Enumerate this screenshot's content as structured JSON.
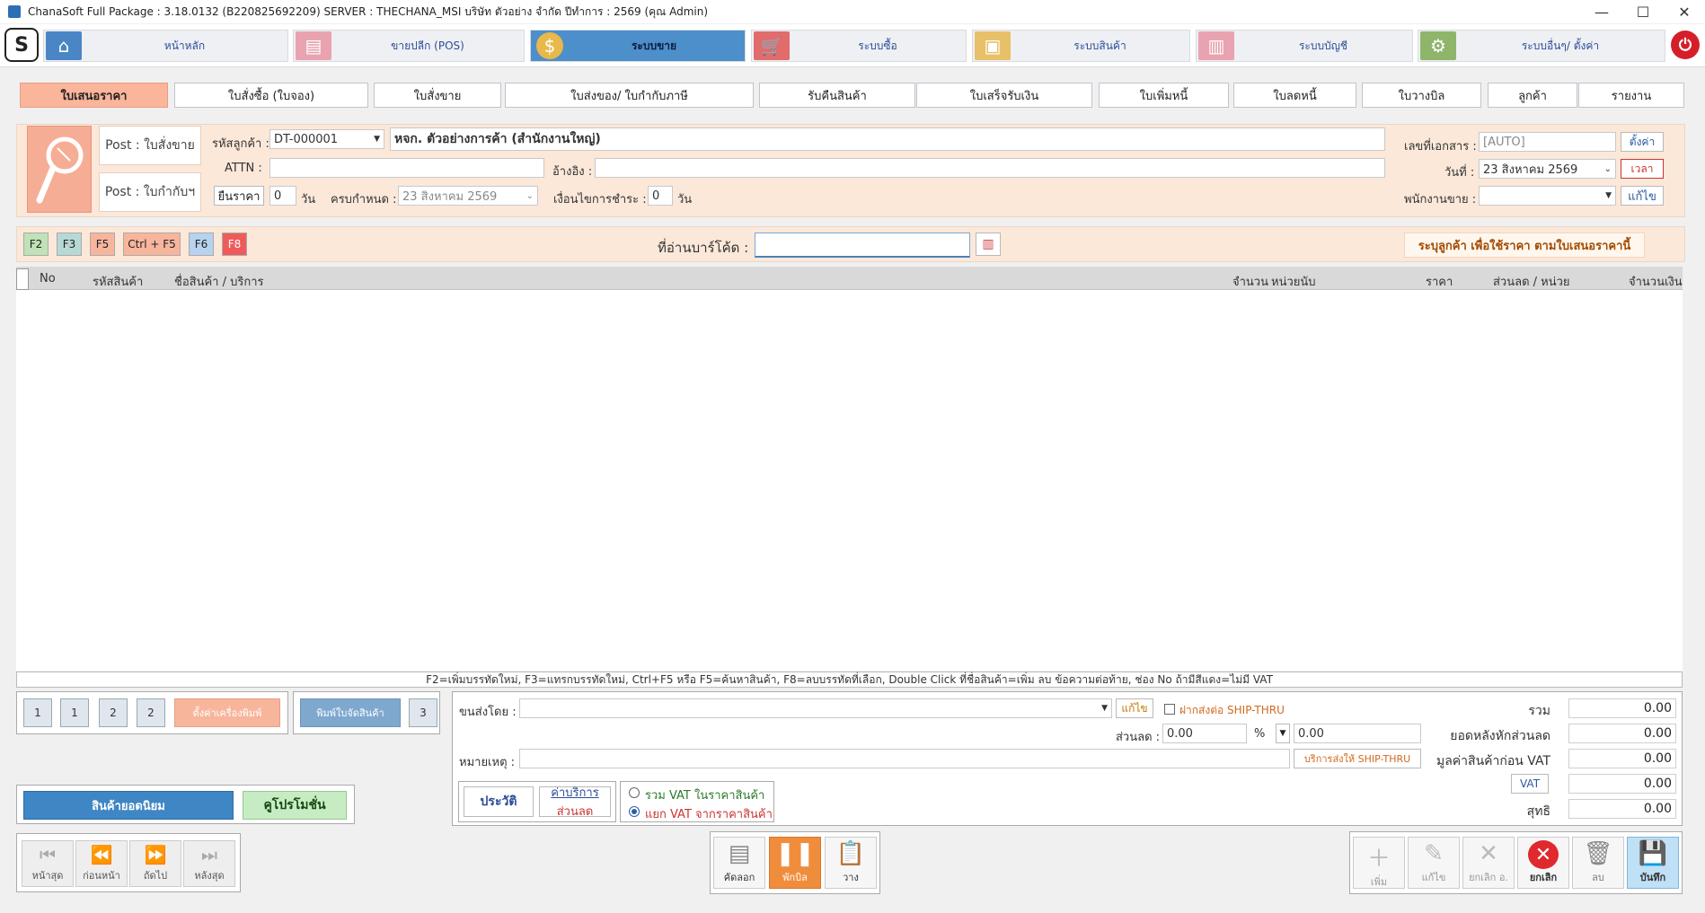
{
  "window": {
    "title": "ChanaSoft Full Package : 3.18.0132 (B220825692209) SERVER : THECHANA_MSI บริษัท ตัวอย่าง จำกัด ปีทำการ : 2569 (คุณ Admin)",
    "minimize": "—",
    "maximize": "☐",
    "close": "✕"
  },
  "main_menu": [
    {
      "label": "หน้าหลัก",
      "icon": "home-icon",
      "color": "#4a86c5"
    },
    {
      "label": "ขายปลีก (POS)",
      "icon": "pos-icon",
      "color": "#e9a3b0"
    },
    {
      "label": "ระบบขาย",
      "icon": "coin-icon",
      "color": "#e8b84a"
    },
    {
      "label": "ระบบซื้อ",
      "icon": "cart-icon",
      "color": "#e26b6b"
    },
    {
      "label": "ระบบสินค้า",
      "icon": "box-icon",
      "color": "#e8c06a"
    },
    {
      "label": "ระบบบัญชี",
      "icon": "report-icon",
      "color": "#e9a3b0"
    },
    {
      "label": "ระบบอื่นๆ/ ตั้งค่า",
      "icon": "gear-icon",
      "color": "#8fb56a"
    }
  ],
  "sub_tabs": [
    "ใบเสนอราคา",
    "ใบสั่งซื้อ (ใบจอง)",
    "ใบสั่งขาย",
    "ใบส่งของ/ ใบกำกับภาษี",
    "รับคืนสินค้า",
    "ใบเสร็จรับเงิน",
    "ใบเพิ่มหนี้",
    "ใบลดหนี้",
    "ใบวางบิล",
    "ลูกค้า",
    "รายงาน"
  ],
  "header": {
    "post_sale": "Post : ใบสั่งขาย",
    "post_invoice": "Post : ใบกำกับฯ",
    "customer_code_label": "รหัสลูกค้า :",
    "customer_code": "DT-000001",
    "customer_name": "หจก. ตัวอย่างการค้า (สำนักงานใหญ่)",
    "attn_label": "ATTN :",
    "attn": "",
    "ref_label": "อ้างอิง :",
    "ref": "",
    "validity_btn": "ยืนราคา",
    "validity_days": "0",
    "day_unit": "วัน",
    "due_label": "ครบกำหนด :",
    "due_date": "23   สิงหาคม     2569",
    "payment_terms_label": "เงื่อนไขการชำระ :",
    "payment_days": "0",
    "payment_unit": "วัน",
    "doc_no_label": "เลขที่เอกสาร :",
    "doc_no": "[AUTO]",
    "setup_btn": "ตั้งค่า",
    "date_label": "วันที่ :",
    "date": "23   สิงหาคม     2569",
    "time_btn": "เวลา",
    "sales_label": "พนักงานขาย :",
    "sales": "",
    "edit_btn": "แก้ไข"
  },
  "toolbar": {
    "keys": [
      "F2",
      "F3",
      "F5",
      "Ctrl + F5",
      "F6",
      "F8"
    ],
    "barcode_label": "ที่อ่านบาร์โค้ด :",
    "barcode_value": "",
    "notice": "ระบุลูกค้า เพื่อใช้ราคา ตามใบเสนอราคานี้"
  },
  "grid": {
    "columns": [
      "No",
      "รหัสสินค้า",
      "ชื่อสินค้า / บริการ",
      "จำนวน",
      "หน่วยนับ",
      "ราคา",
      "ส่วนลด / หน่วย",
      "จำนวนเงิน"
    ],
    "rows": []
  },
  "help_text": "F2=เพิ่มบรรทัดใหม่,   F3=แทรกบรรทัดใหม่,   Ctrl+F5 หรือ F5=ค้นหาสินค้า,   F8=ลบบรรทัดที่เลือก,   Double Click ที่ชื่อสินค้า=เพิ่ม ลบ ข้อความต่อท้าย,   ช่อง No ถ้ามีสีแดง=ไม่มี VAT",
  "print": {
    "setup_label": "ตั้งค่าเครื่องพิมพ์",
    "pick_label": "พิมพ์ใบจัดสินค้า"
  },
  "footer_left": {
    "popular_btn": "สินค้ายอดนิยม",
    "coupon_btn": "คูโปรโมชั่น"
  },
  "delivery": {
    "ship_by_label": "ขนส่งโดย :",
    "ship_by": "",
    "edit_btn": "แก้ไข",
    "ship_thru_label": "ฝากส่งต่อ SHIP-THRU",
    "discount_label": "ส่วนลด :",
    "discount_pct": "0.00",
    "pct_sign": "%",
    "discount_amount": "0.00",
    "remark_label": "หมายเหตุ :",
    "remark": "",
    "ship_thru_service_btn": "บริการส่งให้ SHIP-THRU",
    "history_btn": "ประวัติ",
    "service_fee_btn": "ค่าบริการ",
    "service_disc_btn": "ส่วนลด",
    "vat_incl": "รวม VAT ในราคาสินค้า",
    "vat_excl": "แยก VAT จากราคาสินค้า"
  },
  "totals": {
    "total_label": "รวม",
    "total": "0.00",
    "after_discount_label": "ยอดหลังหักส่วนลด",
    "after_discount": "0.00",
    "before_vat_label": "มูลค่าสินค้าก่อน VAT",
    "before_vat": "0.00",
    "vat_label": "VAT",
    "vat": "0.00",
    "net_label": "สุทธิ",
    "net": "0.00"
  },
  "nav": {
    "first": "หน้าสุด",
    "prev": "ก่อนหน้า",
    "next": "ถัดไป",
    "last": "หลังสุด"
  },
  "center_actions": {
    "copy": "คัดลอก",
    "hold": "พักบิล",
    "paste": "วาง"
  },
  "actions": {
    "add": "เพิ่ม",
    "edit": "แก้ไข",
    "cancel_doc": "ยกเลิก อ.",
    "cancel": "ยกเลิก",
    "delete": "ลบ",
    "save": "บันทึก"
  }
}
